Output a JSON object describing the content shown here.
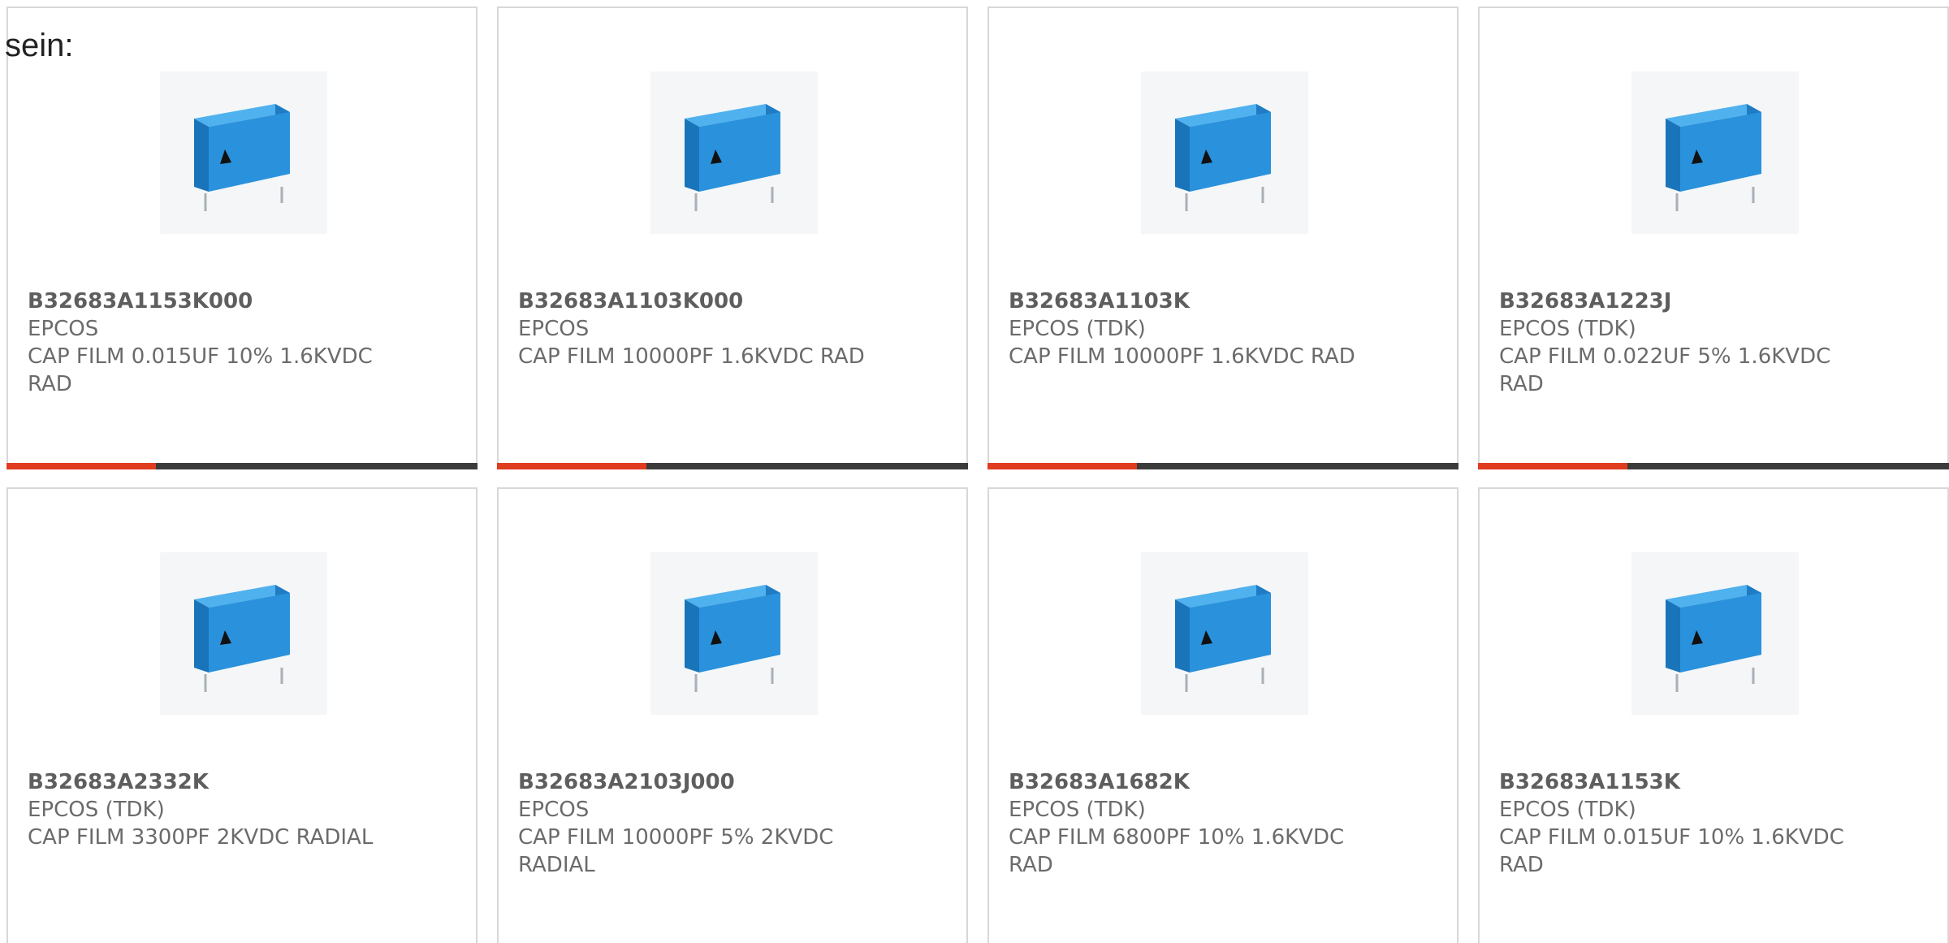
{
  "intro": {
    "text": "sein:"
  },
  "colors": {
    "accent": "#e03c1f",
    "bar": "#3b3b3b",
    "card_border": "#d8d8d8",
    "capacitor_blue": "#2a8fd6"
  },
  "products": [
    {
      "part": "B32683A1153K000",
      "manufacturer": "EPCOS",
      "description": "CAP FILM 0.015UF 10% 1.6KVDC RAD",
      "image_icon": "film-capacitor-icon"
    },
    {
      "part": "B32683A1103K000",
      "manufacturer": "EPCOS",
      "description": "CAP FILM 10000PF 1.6KVDC RAD",
      "image_icon": "film-capacitor-icon"
    },
    {
      "part": "B32683A1103K",
      "manufacturer": "EPCOS (TDK)",
      "description": "CAP FILM 10000PF 1.6KVDC RAD",
      "image_icon": "film-capacitor-icon"
    },
    {
      "part": "B32683A1223J",
      "manufacturer": "EPCOS (TDK)",
      "description": "CAP FILM 0.022UF 5% 1.6KVDC RAD",
      "image_icon": "film-capacitor-icon"
    },
    {
      "part": "B32683A2332K",
      "manufacturer": "EPCOS (TDK)",
      "description": "CAP FILM 3300PF 2KVDC RADIAL",
      "image_icon": "film-capacitor-icon"
    },
    {
      "part": "B32683A2103J000",
      "manufacturer": "EPCOS",
      "description": "CAP FILM 10000PF 5% 2KVDC RADIAL",
      "image_icon": "film-capacitor-icon"
    },
    {
      "part": "B32683A1682K",
      "manufacturer": "EPCOS (TDK)",
      "description": "CAP FILM 6800PF 10% 1.6KVDC RAD",
      "image_icon": "film-capacitor-icon"
    },
    {
      "part": "B32683A1153K",
      "manufacturer": "EPCOS (TDK)",
      "description": "CAP FILM 0.015UF 10% 1.6KVDC RAD",
      "image_icon": "film-capacitor-icon"
    }
  ]
}
